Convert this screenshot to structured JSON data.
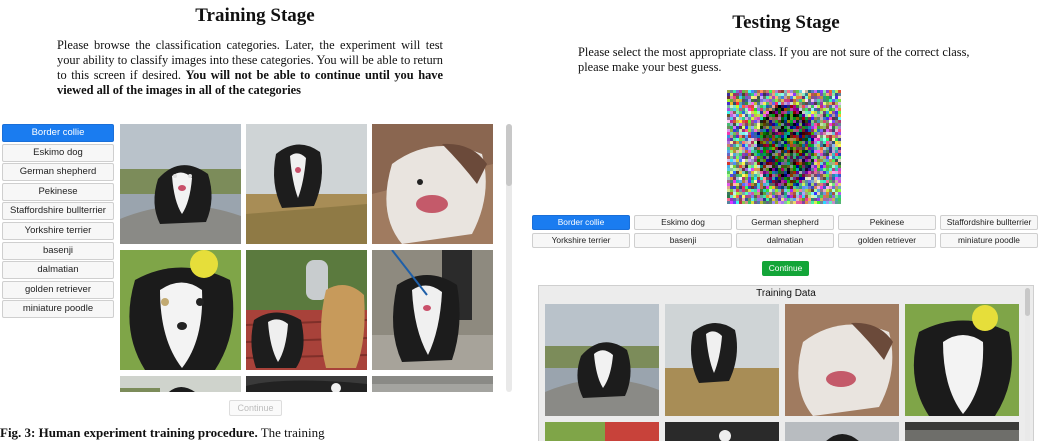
{
  "training": {
    "title": "Training Stage",
    "instructions_plain": "Please browse the classification categories. Later, the experiment will test your ability to classify images into these categories. You will be able to return to this screen if desired. ",
    "instructions_bold": "You will not be able to continue until you have viewed all of the images in all of the categories",
    "categories": [
      "Border collie",
      "Eskimo dog",
      "German shepherd",
      "Pekinese",
      "Staffordshire bullterrier",
      "Yorkshire terrier",
      "basenji",
      "dalmatian",
      "golden retriever",
      "miniature poodle"
    ],
    "selected_category": "Border collie",
    "continue_label": "Continue",
    "continue_enabled": false
  },
  "testing": {
    "title": "Testing Stage",
    "instructions": "Please select the most appropriate class. If you are not sure of the correct class, please make your best guess.",
    "classes": [
      "Border collie",
      "Eskimo dog",
      "German shepherd",
      "Pekinese",
      "Staffordshire bullterrier",
      "Yorkshire terrier",
      "basenji",
      "dalmatian",
      "golden retriever",
      "miniature poodle"
    ],
    "selected_class": "Border collie",
    "continue_label": "Continue",
    "training_data_label": "Training Data"
  },
  "caption": {
    "bold": "Fig. 3: Human experiment training procedure.",
    "text": " The training"
  },
  "colors": {
    "accent_blue": "#1a7cf0",
    "continue_green": "#13a538"
  }
}
